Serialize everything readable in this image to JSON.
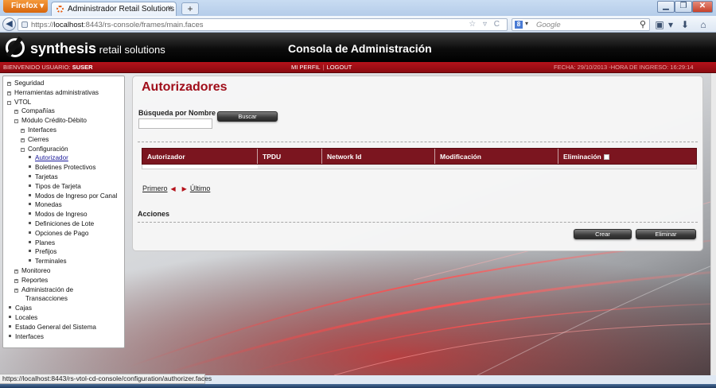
{
  "browser": {
    "menu_button": "Firefox",
    "tab_title": "Administrador Retail Solutions",
    "new_tab": "+",
    "url_prefix": "https://",
    "url_host": "localhost",
    "url_rest": ":8443/rs-console/frames/main.faces",
    "search_placeholder": "Google",
    "status_url": "https://localhost:8443/rs-vtol-cd-console/configuration/authorizer.faces"
  },
  "header": {
    "logo_main": "synthesis",
    "logo_sub": " retail solutions",
    "console_title": "Consola de Administración"
  },
  "userbar": {
    "welcome": "Bienvenido Usuario:",
    "user": "SUSER",
    "profile_link": "MI PERFIL",
    "separator": "|",
    "logout_link": "LOGOUT",
    "date_info": "FECHA: 29/10/2013 -HORA DE INGRESO: 16:29:14"
  },
  "sidebar": {
    "items": [
      {
        "label": "Seguridad",
        "level": 0,
        "marker": "+"
      },
      {
        "label": "Herramientas administrativas",
        "level": 0,
        "marker": "+"
      },
      {
        "label": "VTOL",
        "level": 0,
        "marker": "-"
      },
      {
        "label": "Compañías",
        "level": 1,
        "marker": "+"
      },
      {
        "label": "Módulo Crédito-Débito",
        "level": 1,
        "marker": "-"
      },
      {
        "label": "Interfaces",
        "level": 2,
        "marker": "+"
      },
      {
        "label": "Cierres",
        "level": 2,
        "marker": "+"
      },
      {
        "label": "Configuración",
        "level": 2,
        "marker": "-"
      },
      {
        "label": "Autorizador",
        "level": 3,
        "marker": "dot",
        "active": true
      },
      {
        "label": "Boletines Protectivos",
        "level": 3,
        "marker": "dot"
      },
      {
        "label": "Tarjetas",
        "level": 3,
        "marker": "dot"
      },
      {
        "label": "Tipos de Tarjeta",
        "level": 3,
        "marker": "dot"
      },
      {
        "label": "Modos de Ingreso por Canal",
        "level": 3,
        "marker": "dot"
      },
      {
        "label": "Monedas",
        "level": 3,
        "marker": "dot"
      },
      {
        "label": "Modos de Ingreso",
        "level": 3,
        "marker": "dot"
      },
      {
        "label": "Definiciones de Lote",
        "level": 3,
        "marker": "dot"
      },
      {
        "label": "Opciones de Pago",
        "level": 3,
        "marker": "dot"
      },
      {
        "label": "Planes",
        "level": 3,
        "marker": "dot"
      },
      {
        "label": "Prefijos",
        "level": 3,
        "marker": "dot"
      },
      {
        "label": "Terminales",
        "level": 3,
        "marker": "dot"
      },
      {
        "label": "Monitoreo",
        "level": 1,
        "marker": "+"
      },
      {
        "label": "Reportes",
        "level": 1,
        "marker": "+"
      },
      {
        "label": "Administración de",
        "level": 1,
        "marker": "+"
      },
      {
        "label": "Transacciones",
        "level": 1,
        "marker": "cont"
      },
      {
        "label": "Cajas",
        "level": 0,
        "marker": "dot"
      },
      {
        "label": "Locales",
        "level": 0,
        "marker": "dot"
      },
      {
        "label": "Estado General del Sistema",
        "level": 0,
        "marker": "dot"
      },
      {
        "label": "Interfaces",
        "level": 0,
        "marker": "dot"
      }
    ]
  },
  "main": {
    "title": "Autorizadores",
    "search_label": "Búsqueda por Nombre",
    "search_value": "",
    "search_button": "Buscar",
    "table": {
      "columns": [
        "Autorizador",
        "TPDU",
        "Network Id",
        "Modificación",
        "Eliminación"
      ],
      "rows": []
    },
    "pager": {
      "first": "Primero",
      "last": "Último"
    },
    "actions_label": "Acciones",
    "create_button": "Crear",
    "delete_button": "Eliminar"
  },
  "colors": {
    "accent_red": "#a00e1a",
    "table_header": "#7b151f",
    "header_black": "#0c0c0c"
  }
}
